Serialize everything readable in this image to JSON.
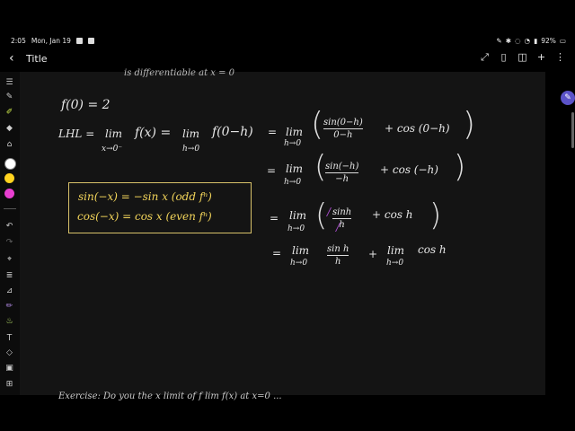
{
  "status": {
    "time": "2:05",
    "date": "Mon, Jan 19",
    "battery": "92%",
    "left_icons": [
      "gallery-icon",
      "check-icon"
    ],
    "right_icons": [
      "edit-icon",
      "bluetooth-icon",
      "mute-icon",
      "wifi-icon",
      "signal-icon"
    ]
  },
  "toolbar": {
    "back_icon": "‹",
    "title": "Title",
    "actions": [
      "expand-icon",
      "book-icon",
      "read-mode-icon",
      "add-icon",
      "more-icon"
    ],
    "action_glyphs": [
      "⤢",
      "▯",
      "◫",
      "+",
      "⋮"
    ]
  },
  "sidebar": {
    "tools": [
      "text-icon",
      "pen-icon",
      "highlighter-icon",
      "eraser-icon",
      "shape-eraser-icon"
    ],
    "colors": [
      "#ffffff",
      "#ffd21f",
      "#e83fd0"
    ],
    "lower_tools": [
      "undo-icon",
      "redo-icon",
      "lasso-icon",
      "align-icon",
      "ruler-icon",
      "pencil-icon",
      "brush-icon",
      "text-box-icon",
      "shapes-icon",
      "image-icon",
      "table-icon"
    ]
  },
  "notes": {
    "top_trim": "is  differentiable  at  x = 0",
    "f0": "f(0) = 2",
    "lhl": "LHL =",
    "lim_x": "lim",
    "lim_x_sub": "x→0⁻",
    "fx": "f(x) =",
    "lim_h": "lim",
    "lim_h_sub": "h→0",
    "f0h": "f(0−h)",
    "eq1_eq": "=",
    "eq1_num": "sin(0−h)",
    "eq1_den": "0−h",
    "eq1_cos": "+  cos (0−h)",
    "eq2_eq": "=",
    "eq2_num": "sin(−h)",
    "eq2_den": "−h",
    "eq2_cos": "+  cos (−h)",
    "eq3_eq": "=",
    "eq3_num": "sinh",
    "eq3_den": "h",
    "eq3_cos": "+  cos h",
    "eq4_eq": "=",
    "eq4_num": "sin h",
    "eq4_den": "h",
    "eq4_plus": "+",
    "eq4_cos": "cos h",
    "box_line1": "sin(−x) = −sin x   (odd fⁿ)",
    "box_line2": "cos(−x) = cos x    (even fⁿ)",
    "bottom_trim": "Exercise:   Do you the x limit of   f  lim  f(x)  at  x=0 ..."
  }
}
